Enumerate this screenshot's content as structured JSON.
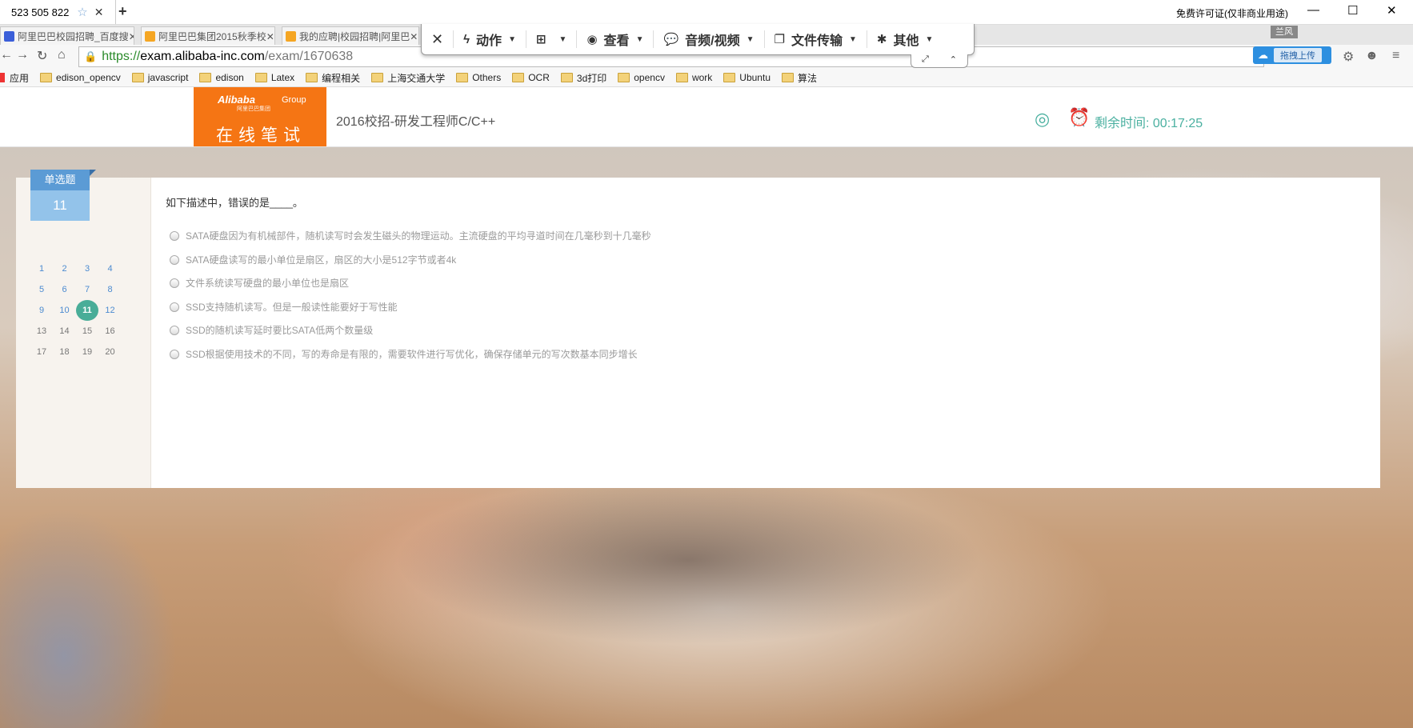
{
  "titlebar": {
    "tab_label": "523 505 822",
    "license": "免费许可证(仅非商业用途)"
  },
  "browser_tabs": [
    {
      "label": "阿里巴巴校园招聘_百度搜"
    },
    {
      "label": "阿里巴巴集团2015秋季校"
    },
    {
      "label": "我的应聘|校园招聘|阿里巴"
    }
  ],
  "remote_toolbar": {
    "items": [
      "动作",
      "查看",
      "音频/视频",
      "文件传输",
      "其他"
    ]
  },
  "badge": "兰风",
  "address": {
    "https": "https://",
    "host": "exam.alibaba-inc.com",
    "path": "/exam/1670638"
  },
  "upload_label": "拖拽上传",
  "bookmarks": {
    "apps": "应用",
    "items": [
      "edison_opencv",
      "javascript",
      "edison",
      "Latex",
      "编程相关",
      "上海交通大学",
      "Others",
      "OCR",
      "3d打印",
      "opencv",
      "work",
      "Ubuntu",
      "算法"
    ]
  },
  "header": {
    "logo_brand": "Alibaba",
    "logo_group": "Group",
    "logo_cn": "阿里巴巴集团",
    "logo_sub": "在线笔试",
    "exam_title": "2016校招-研发工程师C/C++",
    "timer": "剩余时间: 00:17:25"
  },
  "question": {
    "type": "单选题",
    "number": "11",
    "text": "如下描述中，错误的是____。",
    "options": [
      "SATA硬盘因为有机械部件，随机读写时会发生磁头的物理运动。主流硬盘的平均寻道时间在几毫秒到十几毫秒",
      "SATA硬盘读写的最小单位是扇区，扇区的大小是512字节或者4k",
      "文件系统读写硬盘的最小单位也是扇区",
      "SSD支持随机读写。但是一般读性能要好于写性能",
      "SSD的随机读写延时要比SATA低两个数量级",
      "SSD根据使用技术的不同，写的寿命是有限的，需要软件进行写优化，确保存储单元的写次数基本同步增长"
    ]
  },
  "nav_grid": [
    "1",
    "2",
    "3",
    "4",
    "5",
    "6",
    "7",
    "8",
    "9",
    "10",
    "11",
    "12",
    "13",
    "14",
    "15",
    "16",
    "17",
    "18",
    "19",
    "20"
  ],
  "current_question": "11",
  "colors": {
    "accent_orange": "#f57514",
    "teal": "#49ad98",
    "blue": "#5b9bd5"
  }
}
